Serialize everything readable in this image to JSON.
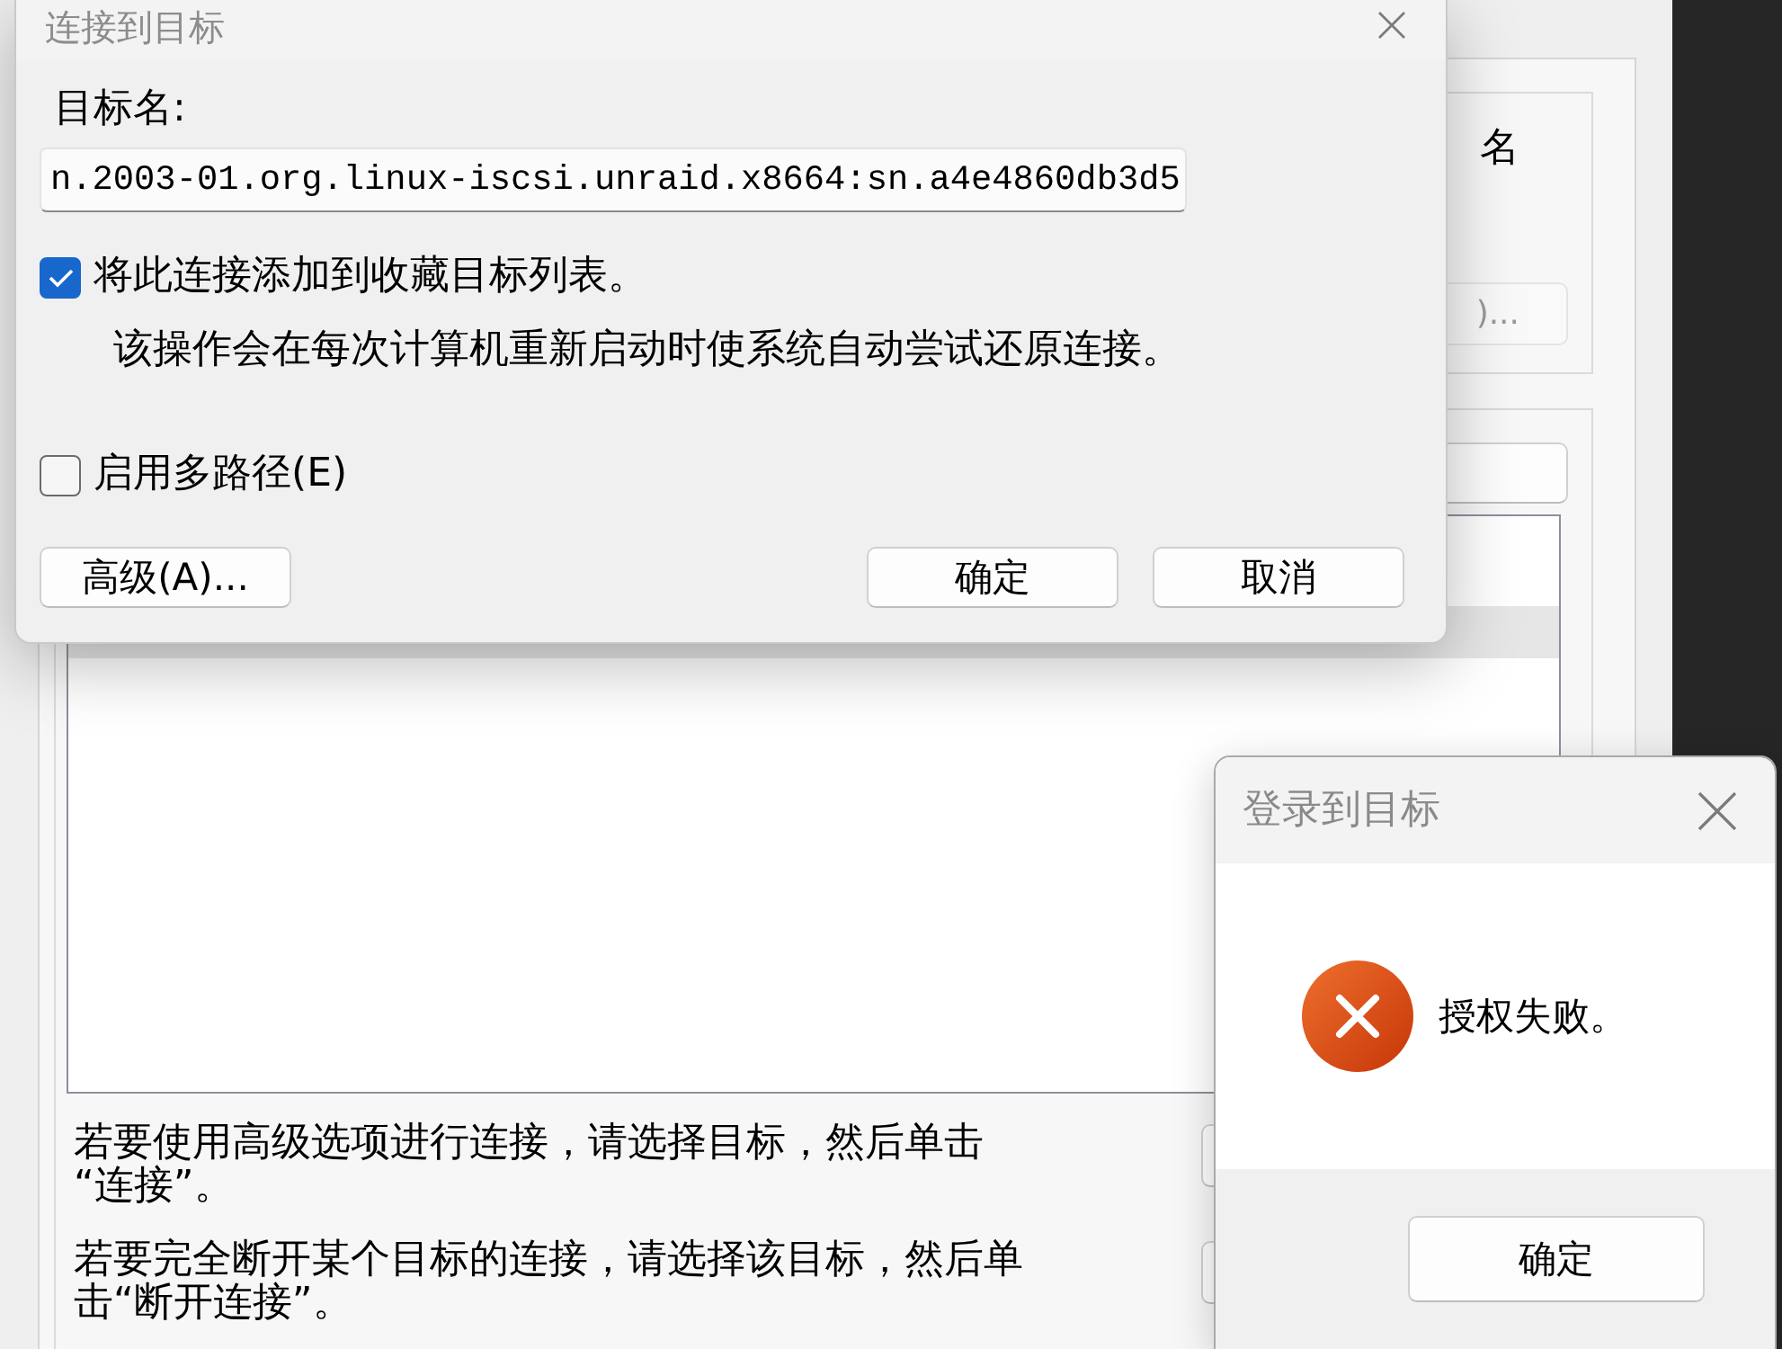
{
  "background_window": {
    "partial_label": "名",
    "partial_button": ")...",
    "list": {
      "rows": [
        {
          "selected": true
        }
      ]
    },
    "hints": [
      {
        "lines": [
          "若要使用高级选项进行连接，请选择目标，然后单击",
          "“连接”。"
        ]
      },
      {
        "lines": [
          "若要完全断开某个目标的连接，请选择该目标，然后单",
          "击“断开连接”。"
        ]
      }
    ]
  },
  "connect_dialog": {
    "title": "连接到目标",
    "target_name_label": "目标名:",
    "target_name_value": "n.2003-01.org.linux-iscsi.unraid.x8664:sn.a4e4860db3d5",
    "favorite": {
      "label": "将此连接添加到收藏目标列表。",
      "checked": true,
      "note": "该操作会在每次计算机重新启动时使系统自动尝试还原连接。"
    },
    "multipath": {
      "label": "启用多路径(E)",
      "checked": false
    },
    "buttons": [
      "高级(A)...",
      "确定",
      "取消"
    ]
  },
  "message_box": {
    "title": "登录到目标",
    "message": "授权失败。",
    "buttons": [
      "确定"
    ]
  }
}
